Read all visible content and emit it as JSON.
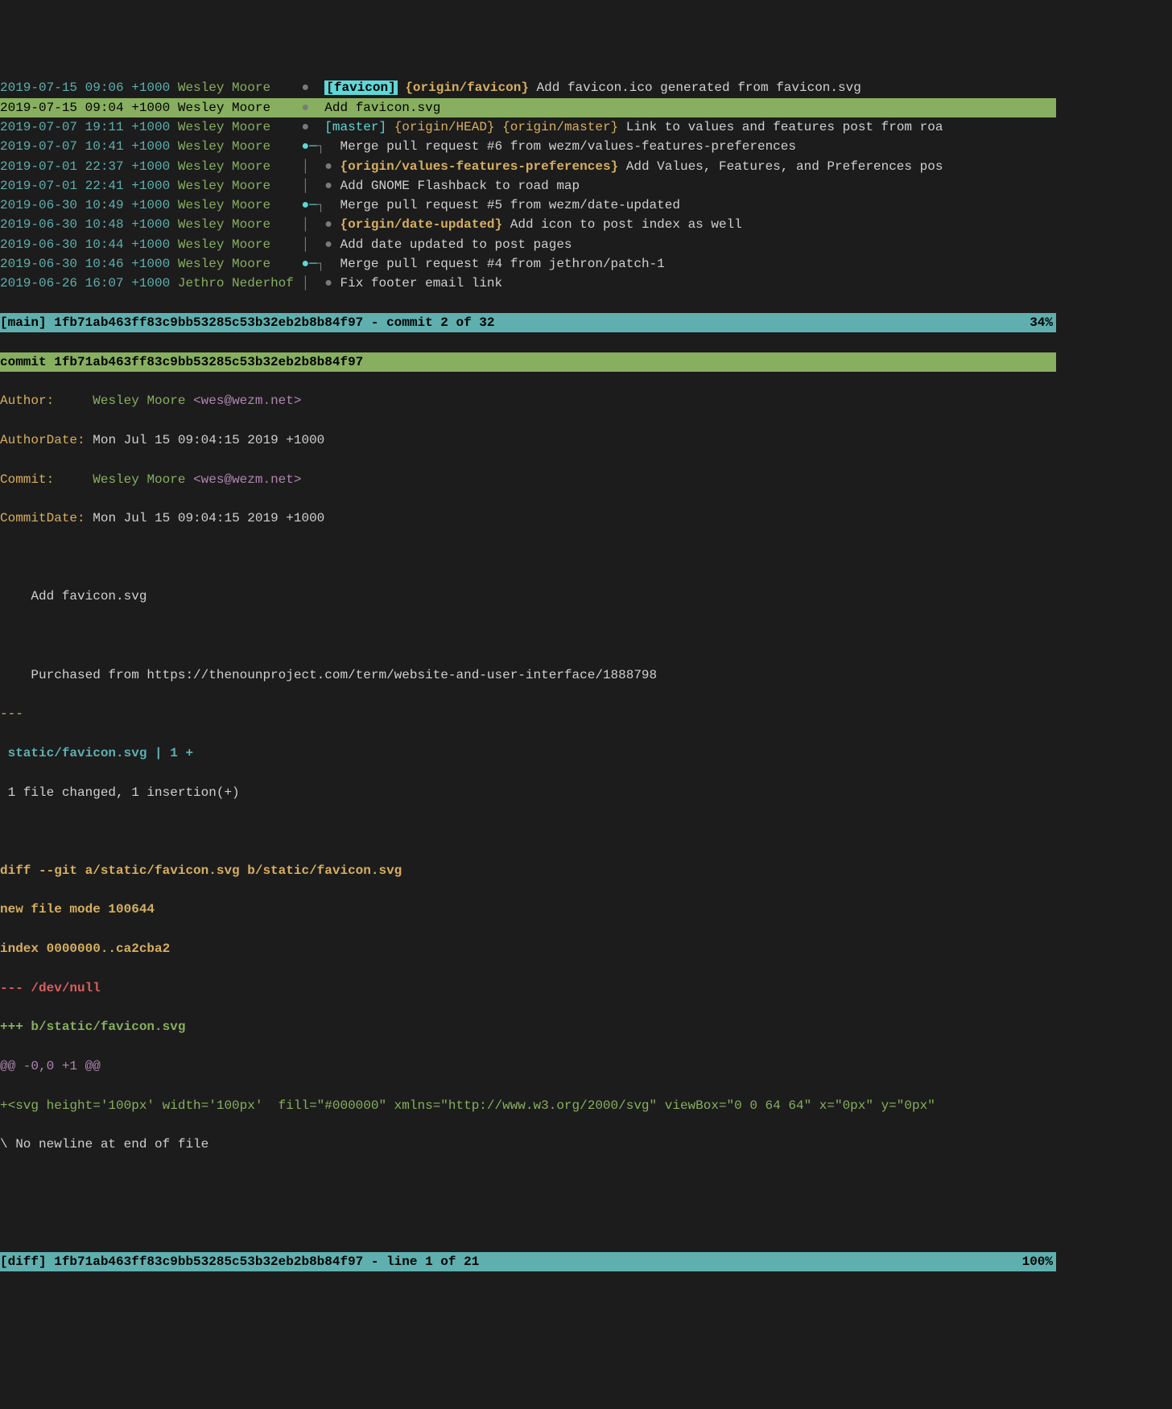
{
  "log": [
    {
      "date": "2019-07-15 09:06 +1000",
      "author": "Wesley Moore",
      "selected": false,
      "graph": "",
      "mergeDot": false,
      "currentBranch": "[favicon]",
      "remoteBranch": "{origin/favicon}",
      "subject": "Add favicon.ico generated from favicon.svg"
    },
    {
      "date": "2019-07-15 09:04 +1000",
      "author": "Wesley Moore",
      "selected": true,
      "graph": "",
      "mergeDot": false,
      "currentBranch": "",
      "remoteBranch": "",
      "subject": "Add favicon.svg"
    },
    {
      "date": "2019-07-07 19:11 +1000",
      "author": "Wesley Moore",
      "selected": false,
      "graph": "",
      "mergeDot": false,
      "localBranchCyan": "[master]",
      "originHead": "{origin/HEAD} {origin/master}",
      "subject": "Link to values and features post from roa"
    },
    {
      "date": "2019-07-07 10:41 +1000",
      "author": "Wesley Moore",
      "selected": false,
      "graph": "merge-start",
      "mergeDot": true,
      "subject": "Merge pull request #6 from wezm/values-features-preferences"
    },
    {
      "date": "2019-07-01 22:37 +1000",
      "author": "Wesley Moore",
      "selected": false,
      "graph": "|   ",
      "mergeDot": false,
      "remoteBranch": "{origin/values-features-preferences}",
      "subject": "Add Values, Features, and Preferences pos"
    },
    {
      "date": "2019-07-01 22:41 +1000",
      "author": "Wesley Moore",
      "selected": false,
      "graph": "|   ",
      "mergeDot": false,
      "subject": "Add GNOME Flashback to road map"
    },
    {
      "date": "2019-06-30 10:49 +1000",
      "author": "Wesley Moore",
      "selected": false,
      "graph": "merge-start",
      "mergeDot": true,
      "subject": "Merge pull request #5 from wezm/date-updated"
    },
    {
      "date": "2019-06-30 10:48 +1000",
      "author": "Wesley Moore",
      "selected": false,
      "graph": "|   ",
      "mergeDot": false,
      "remoteBranch": "{origin/date-updated}",
      "subject": "Add icon to post index as well"
    },
    {
      "date": "2019-06-30 10:44 +1000",
      "author": "Wesley Moore",
      "selected": false,
      "graph": "|   ",
      "mergeDot": false,
      "subject": "Add date updated to post pages"
    },
    {
      "date": "2019-06-30 10:46 +1000",
      "author": "Wesley Moore",
      "selected": false,
      "graph": "merge-start",
      "mergeDot": true,
      "subject": "Merge pull request #4 from jethron/patch-1"
    },
    {
      "date": "2019-06-26 16:07 +1000",
      "author": "Jethro Nederhof",
      "selected": false,
      "graph": "|   ",
      "mergeDot": false,
      "subject": "Fix footer email link"
    }
  ],
  "status_top": {
    "left": "[main] 1fb71ab463ff83c9bb53285c53b32eb2b8b84f97 - commit 2 of 32",
    "right": "34%"
  },
  "commit_header": "commit 1fb71ab463ff83c9bb53285c53b32eb2b8b84f97",
  "details": {
    "author_label": "Author:    ",
    "author_name": "Wesley Moore ",
    "author_email": "<wes@wezm.net>",
    "authordate_label": "AuthorDate:",
    "authordate": "Mon Jul 15 09:04:15 2019 +1000",
    "commit_label": "Commit:    ",
    "commit_name": "Wesley Moore ",
    "commit_email": "<wes@wezm.net>",
    "commitdate_label": "CommitDate:",
    "commitdate": "Mon Jul 15 09:04:15 2019 +1000"
  },
  "message": {
    "title": "Add favicon.svg",
    "body": "Purchased from https://thenounproject.com/term/website-and-user-interface/1888798"
  },
  "diffstat": {
    "marker": "---",
    "file_line": " static/favicon.svg | 1 +",
    "summary": " 1 file changed, 1 insertion(+)"
  },
  "diff": {
    "header": "diff --git a/static/favicon.svg b/static/favicon.svg",
    "newfile": "new file mode 100644",
    "index": "index 0000000..ca2cba2",
    "min3": "--- /dev/null",
    "plus3": "+++ b/static/favicon.svg",
    "hunk": "@@ -0,0 +1 @@",
    "add": "+<svg height='100px' width='100px'  fill=\"#000000\" xmlns=\"http://www.w3.org/2000/svg\" viewBox=\"0 0 64 64\" x=\"0px\" y=\"0px\"",
    "nonewline": "\\ No newline at end of file"
  },
  "status_bottom": {
    "left": "[diff] 1fb71ab463ff83c9bb53285c53b32eb2b8b84f97 - line 1 of 21",
    "right": "100%"
  }
}
